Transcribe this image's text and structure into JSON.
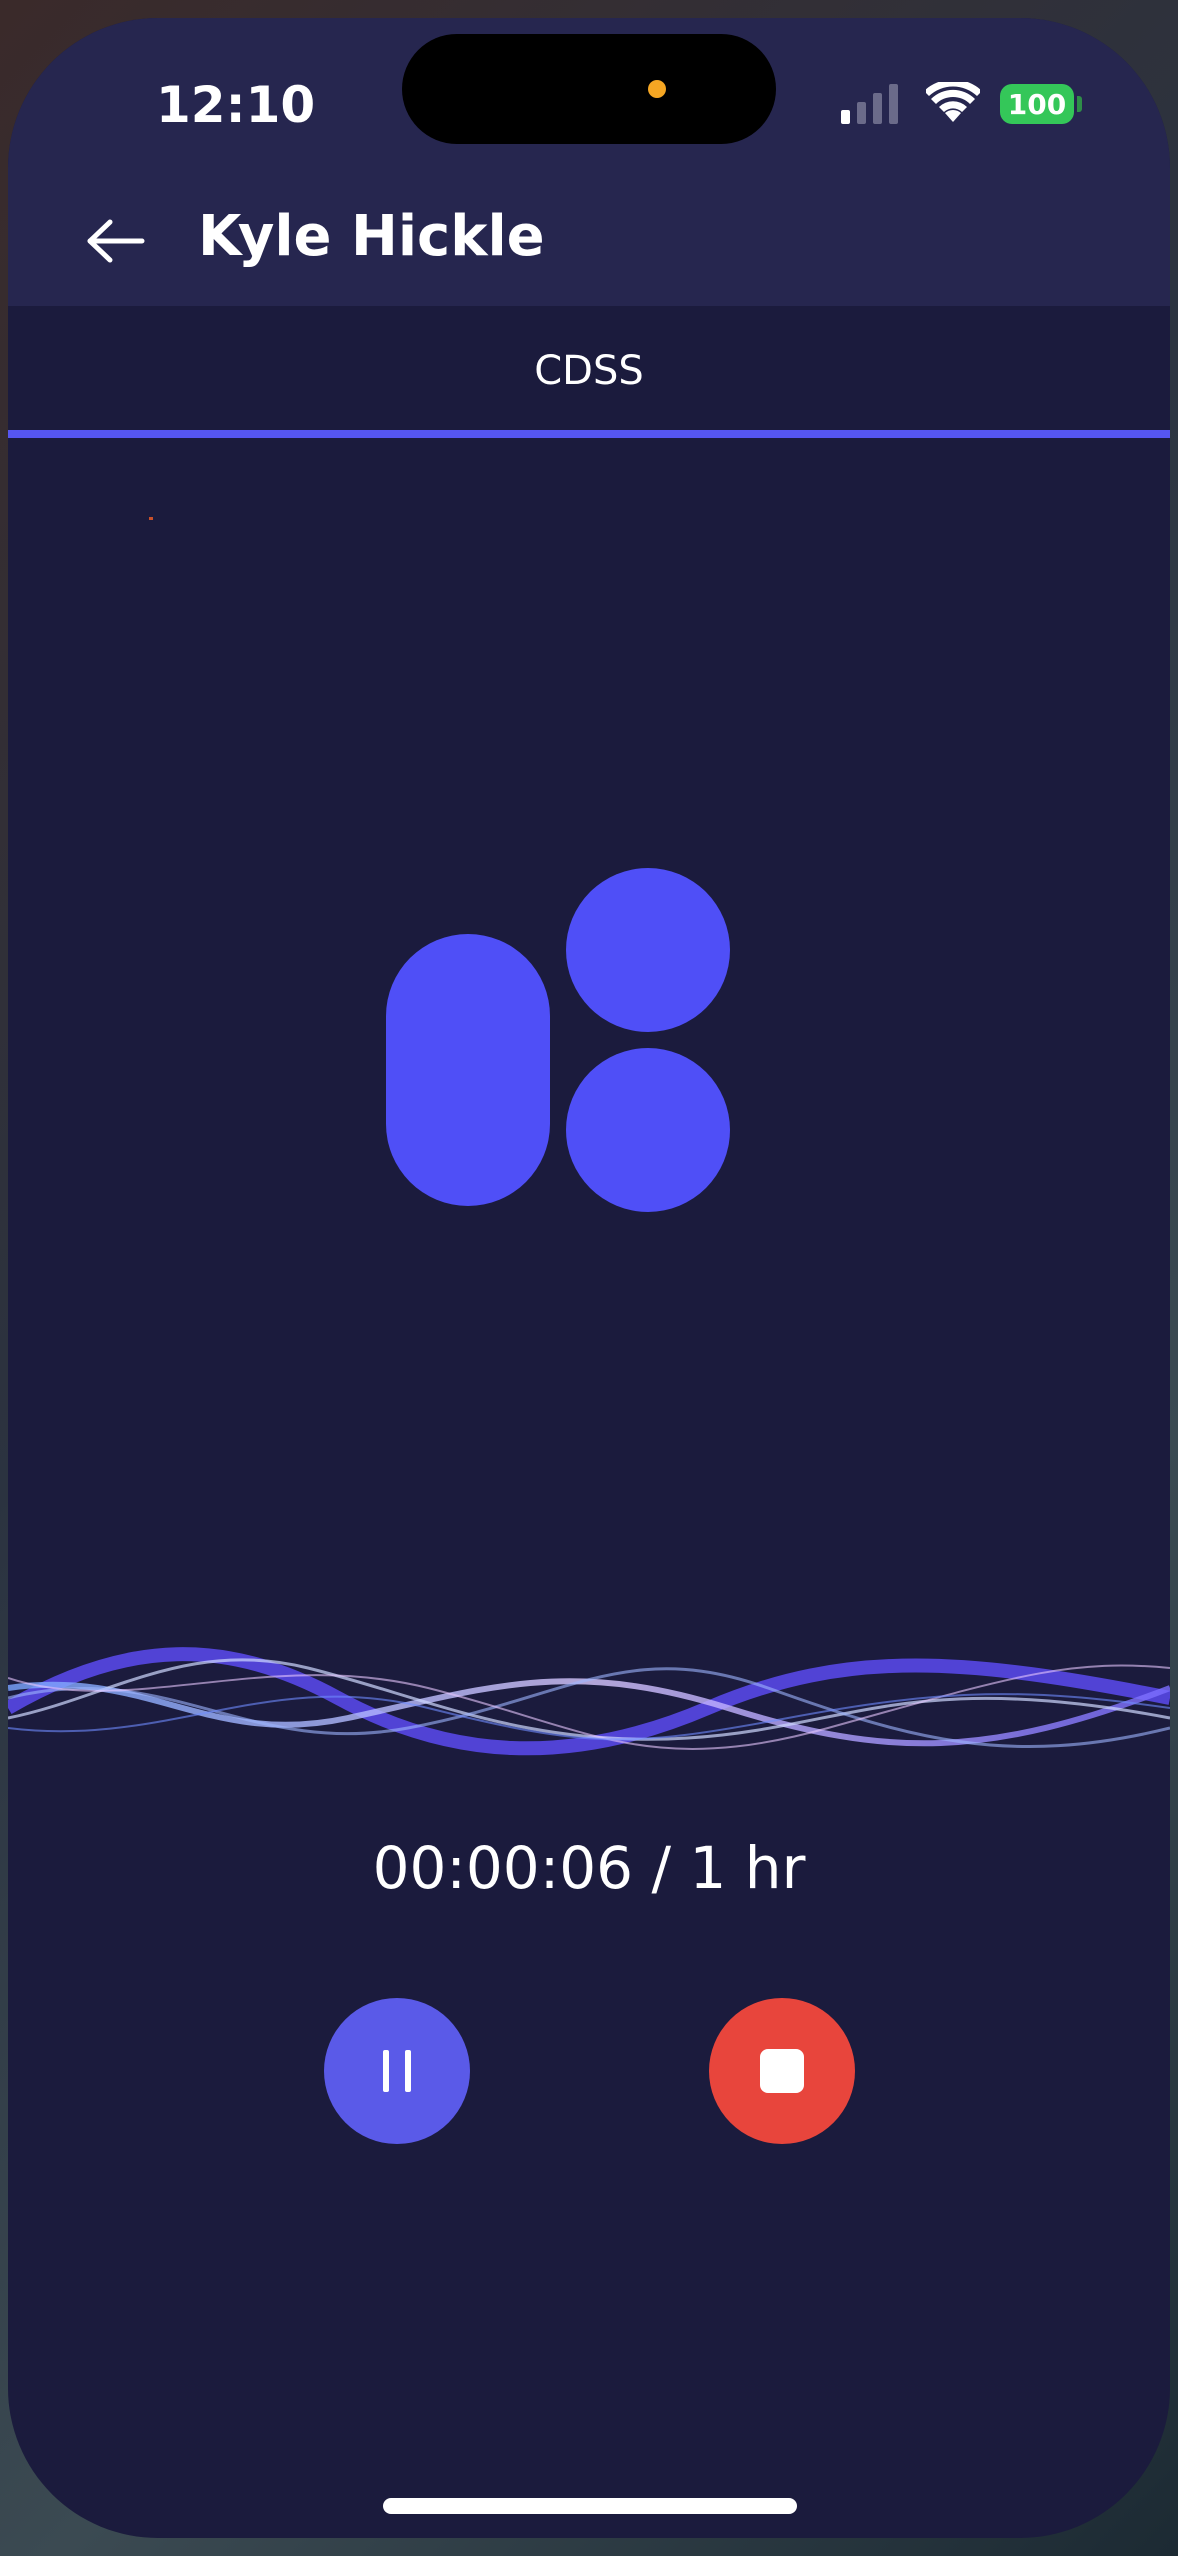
{
  "status_bar": {
    "time": "12:10",
    "battery": "100",
    "battery_color": "#34c759"
  },
  "header": {
    "title": "Kyle Hickle",
    "back_icon": "arrow-left-icon"
  },
  "tabs": [
    {
      "label": "CDSS",
      "active": true
    }
  ],
  "recorder": {
    "timer": "00:00:06 / 1 hr",
    "pause_icon": "pause-icon",
    "stop_icon": "stop-icon"
  },
  "colors": {
    "background": "#1b1b3d",
    "header_bg": "#26264f",
    "accent": "#5656f0",
    "logo": "#4f4ff7",
    "pause_button": "#5a5ae8",
    "stop_button": "#e8453c"
  }
}
